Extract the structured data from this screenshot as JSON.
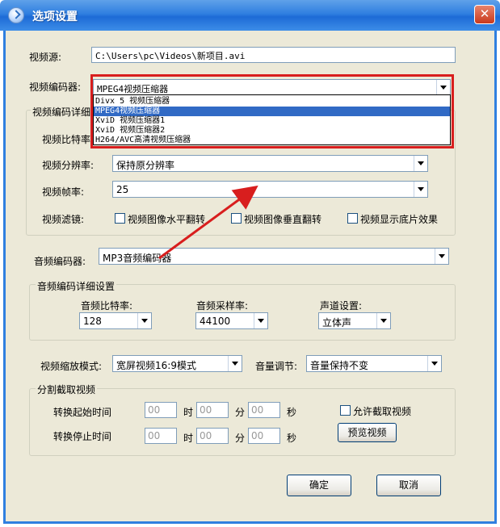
{
  "window": {
    "title": "选项设置",
    "close_glyph": "✕"
  },
  "video_source": {
    "label": "视频源:",
    "value": "C:\\Users\\pc\\Videos\\新项目.avi"
  },
  "video_encoder": {
    "label": "视频编码器:",
    "selected": "MPEG4视频压缩器",
    "options": [
      "Divx 5 视频压缩器",
      "MPEG4视频压缩器",
      "XviD 视频压缩器1",
      "XviD 视频压缩器2",
      "H264/AVC高清视频压缩器"
    ],
    "selected_index": 1
  },
  "video_detail_group": {
    "title": "视频编码详细",
    "bitrate_label": "视频比特率",
    "resolution_label": "视频分辨率:",
    "resolution_value": "保持原分辨率",
    "framerate_label": "视频帧率:",
    "framerate_value": "25",
    "filter_label": "视频滤镜:",
    "filters": [
      "视频图像水平翻转",
      "视频图像垂直翻转",
      "视频显示底片效果"
    ]
  },
  "audio_encoder": {
    "label": "音频编码器:",
    "value": "MP3音频编码器"
  },
  "audio_detail_group": {
    "title": "音频编码详细设置",
    "bitrate_label": "音频比特率:",
    "bitrate_value": "128",
    "samplerate_label": "音频采样率:",
    "samplerate_value": "44100",
    "channel_label": "声道设置:",
    "channel_value": "立体声"
  },
  "scale_mode": {
    "label": "视频缩放模式:",
    "value": "宽屏视频16:9模式"
  },
  "volume": {
    "label": "音量调节:",
    "value": "音量保持不变"
  },
  "split_group": {
    "title": "分割截取视频",
    "start_label": "转换起始时间",
    "stop_label": "转换停止时间",
    "hour_unit": "时",
    "minute_unit": "分",
    "second_unit": "秒",
    "field_placeholder": "00",
    "allow_label": "允许截取视频",
    "preview_button": "预览视频"
  },
  "buttons": {
    "ok": "确定",
    "cancel": "取消"
  },
  "colors": {
    "titlebar": "#2f7fe0",
    "dialog_bg": "#ece9d8",
    "highlight": "#316ac5",
    "annotation_red": "#d81e1e"
  }
}
